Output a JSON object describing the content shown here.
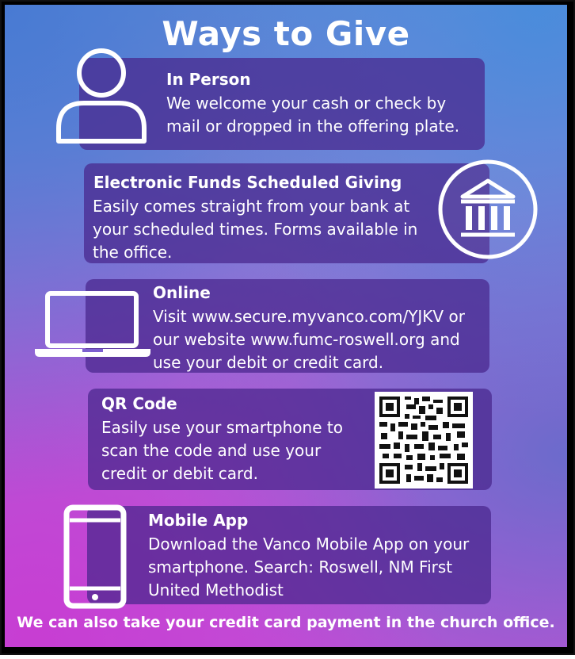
{
  "title": "Ways to Give",
  "sections": [
    {
      "heading": "In Person",
      "text": "We welcome your cash or check by mail or dropped in the offering plate.",
      "icon": "person-icon"
    },
    {
      "heading": "Electronic Funds Scheduled Giving",
      "text": "Easily comes straight from your bank at your scheduled times. Forms available in the office.",
      "icon": "bank-icon"
    },
    {
      "heading": "Online",
      "text": "Visit www.secure.myvanco.com/YJKV or our website www.fumc-roswell.org and use your debit or credit card.",
      "icon": "laptop-icon"
    },
    {
      "heading": "QR Code",
      "text": "Easily use your smartphone to scan the code and use your credit or debit card.",
      "icon": "qr-code-icon"
    },
    {
      "heading": "Mobile App",
      "text": "Download the Vanco Mobile App on your smartphone. Search: Roswell, NM First United Methodist",
      "icon": "smartphone-icon"
    }
  ],
  "footer": "We can also take your credit card payment in the church office.",
  "colors": {
    "card": "#48268c",
    "text": "#ffffff",
    "border": "#111111"
  }
}
